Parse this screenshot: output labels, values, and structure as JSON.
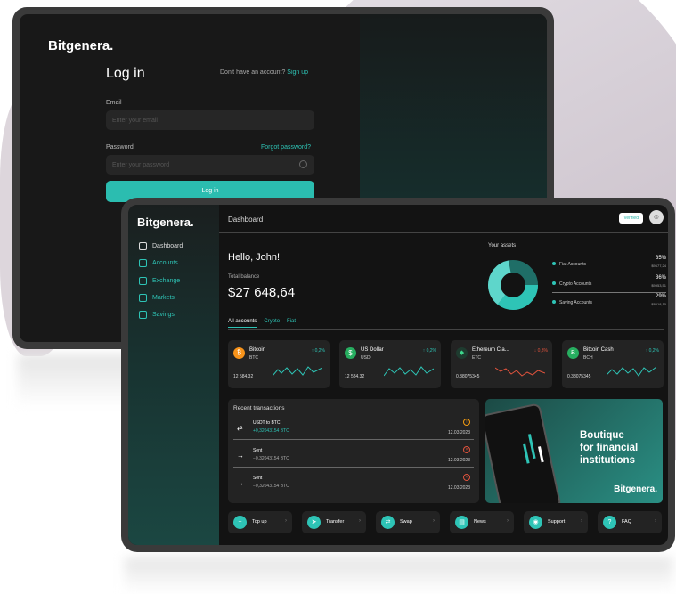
{
  "login": {
    "brand": "Bitgenera.",
    "title": "Log in",
    "no_account_text": "Don't have an account?",
    "signup_link": "Sign up",
    "email_label": "Email",
    "email_placeholder": "Enter your email",
    "password_label": "Password",
    "forgot_link": "Forgot password?",
    "password_placeholder": "Enter your password",
    "login_button": "Log in"
  },
  "dashboard": {
    "brand": "Bitgenera.",
    "title": "Dashboard",
    "verified_badge": "Verified",
    "nav": [
      {
        "label": "Dashboard",
        "active": true
      },
      {
        "label": "Accounts"
      },
      {
        "label": "Exchange"
      },
      {
        "label": "Markets"
      },
      {
        "label": "Savings"
      }
    ],
    "greeting": "Hello, John!",
    "total_balance_label": "Total balance",
    "total_balance": "$27 648,64",
    "your_assets_label": "Your assets",
    "assets": [
      {
        "name": "Fiat Accounts",
        "percent": "35%",
        "amount": "$9677,24"
      },
      {
        "name": "Crypto Accounts",
        "percent": "36%",
        "amount": "$9953,51"
      },
      {
        "name": "Saving Accounts",
        "percent": "29%",
        "amount": "$8018,10"
      }
    ],
    "tabs": [
      "All accounts",
      "Crypto",
      "Fiat"
    ],
    "cards": [
      {
        "name": "Bitcoin",
        "ticker": "BTC",
        "change": "↑ 0,2%",
        "amount": "12 584,32",
        "color": "#f7931a",
        "symbol": "₿"
      },
      {
        "name": "US Dollar",
        "ticker": "USD",
        "change": "↑ 0,2%",
        "amount": "12 584,32",
        "color": "#27ae60",
        "symbol": "$"
      },
      {
        "name": "Ethereum Cla...",
        "ticker": "ETC",
        "change": "↓ 0,3%",
        "amount": "0,38075345",
        "color": "#3d9b6b",
        "symbol": "◆"
      },
      {
        "name": "Bitcoin Cash",
        "ticker": "BCH",
        "change": "↑ 0,2%",
        "amount": "0,38075345",
        "color": "#27ae60",
        "symbol": "Ƀ"
      }
    ],
    "recent_label": "Recent transactions",
    "transactions": [
      {
        "title": "USDT to BTC",
        "amount": "+0,32043154 BTC",
        "date": "12.03.2023",
        "arrow": "⇄"
      },
      {
        "title": "Sent",
        "amount": "−0,32043154 BTC",
        "date": "12.03.2023",
        "arrow": "→"
      },
      {
        "title": "Sent",
        "amount": "−0,32043154 BTC",
        "date": "12.03.2023",
        "arrow": "→"
      }
    ],
    "banner_text_1": "Boutique",
    "banner_text_2": "for financial",
    "banner_text_3": "institutions",
    "banner_brand": "Bitgenera.",
    "actions": [
      "Top up",
      "Transfer",
      "Swap",
      "News",
      "Support",
      "FAQ"
    ]
  },
  "colors": {
    "accent": "#2ec4b6",
    "up": "#2ec4b6",
    "down": "#e0533d",
    "pending": "#f39c12"
  }
}
